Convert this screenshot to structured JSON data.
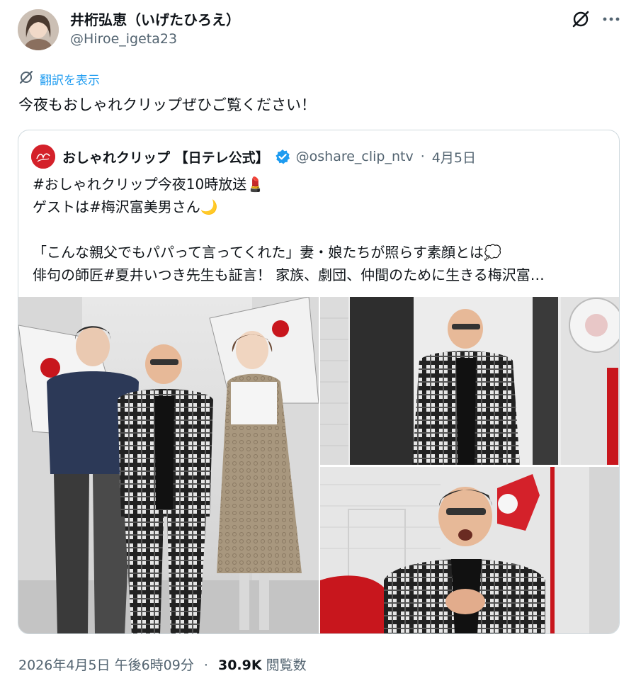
{
  "author": {
    "name": "井桁弘恵（いげたひろえ）",
    "handle": "@Hiroe_igeta23"
  },
  "translate_label": "翻訳を表示",
  "tweet_text": "今夜もおしゃれクリップぜひご覧ください！",
  "quote": {
    "name": "おしゃれクリップ 【日テレ公式】",
    "handle": "@oshare_clip_ntv",
    "separator": "·",
    "date": "4月5日",
    "lines": [
      "#おしゃれクリップ今夜10時放送💄",
      "ゲストは#梅沢富美男さん🌙",
      "",
      "「こんな親父でもパパって言ってくれた」妻・娘たちが照らす素顔とは💭",
      "俳句の師匠#夏井いつき先生も証言！ 家族、劇団、仲間のために生きる梅沢富…"
    ]
  },
  "meta": {
    "timestamp": "2026年4月5日 午後6時09分",
    "separator": "·",
    "views": "30.9K",
    "views_label": "閲覧数"
  },
  "icons": {
    "grok": "grok-icon",
    "more": "more-icon",
    "translate": "translate-icon",
    "verified": "verified-badge-icon"
  },
  "colors": {
    "link": "#1d9bf0",
    "secondary_text": "#536471",
    "border": "#cfd9de",
    "brand_red": "#d4212a"
  }
}
